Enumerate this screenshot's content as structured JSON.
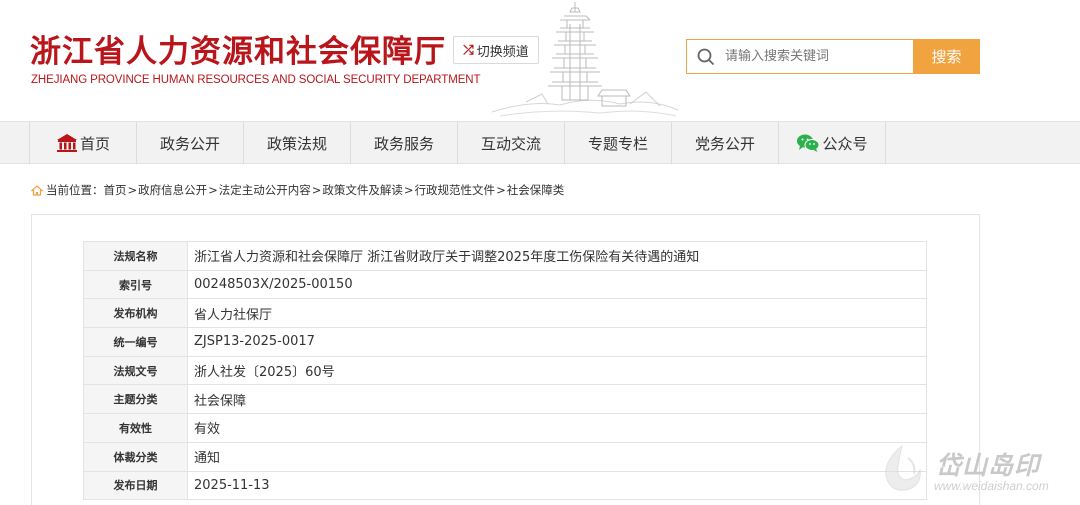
{
  "header": {
    "logo_cn": "浙江省人力资源和社会保障厅",
    "logo_en": "ZHEJIANG PROVINCE HUMAN RESOURCES AND SOCIAL SECURITY DEPARTMENT",
    "switch_label": "切换频道",
    "search_placeholder": "请输入搜索关键词",
    "search_button": "搜索"
  },
  "nav": {
    "items": [
      {
        "label": "首页",
        "icon": "home-icon"
      },
      {
        "label": "政务公开"
      },
      {
        "label": "政策法规"
      },
      {
        "label": "政务服务"
      },
      {
        "label": "互动交流"
      },
      {
        "label": "专题专栏"
      },
      {
        "label": "党务公开"
      },
      {
        "label": "公众号",
        "icon": "wechat-icon"
      }
    ]
  },
  "breadcrumb": {
    "prefix": "当前位置：",
    "items": [
      "首页",
      "政府信息公开",
      "法定主动公开内容",
      "政策文件及解读",
      "行政规范性文件",
      "社会保障类"
    ],
    "separator": ">"
  },
  "info": [
    {
      "key": "法规名称",
      "value": "浙江省人力资源和社会保障厅 浙江省财政厅关于调整2025年度工伤保险有关待遇的通知"
    },
    {
      "key": "索引号",
      "value": "00248503X/2025-00150"
    },
    {
      "key": "发布机构",
      "value": "省人力社保厅"
    },
    {
      "key": "统一编号",
      "value": "ZJSP13-2025-0017"
    },
    {
      "key": "法规文号",
      "value": "浙人社发〔2025〕60号"
    },
    {
      "key": "主题分类",
      "value": "社会保障"
    },
    {
      "key": "有效性",
      "value": "有效"
    },
    {
      "key": "体裁分类",
      "value": "通知"
    },
    {
      "key": "发布日期",
      "value": "2025-11-13"
    }
  ],
  "watermark": {
    "text": "岱山岛印",
    "url": "www.weidaishan.com"
  },
  "colors": {
    "brand_red": "#b8161b",
    "search_orange": "#f0a33f",
    "nav_bg": "#f2f2f2"
  }
}
